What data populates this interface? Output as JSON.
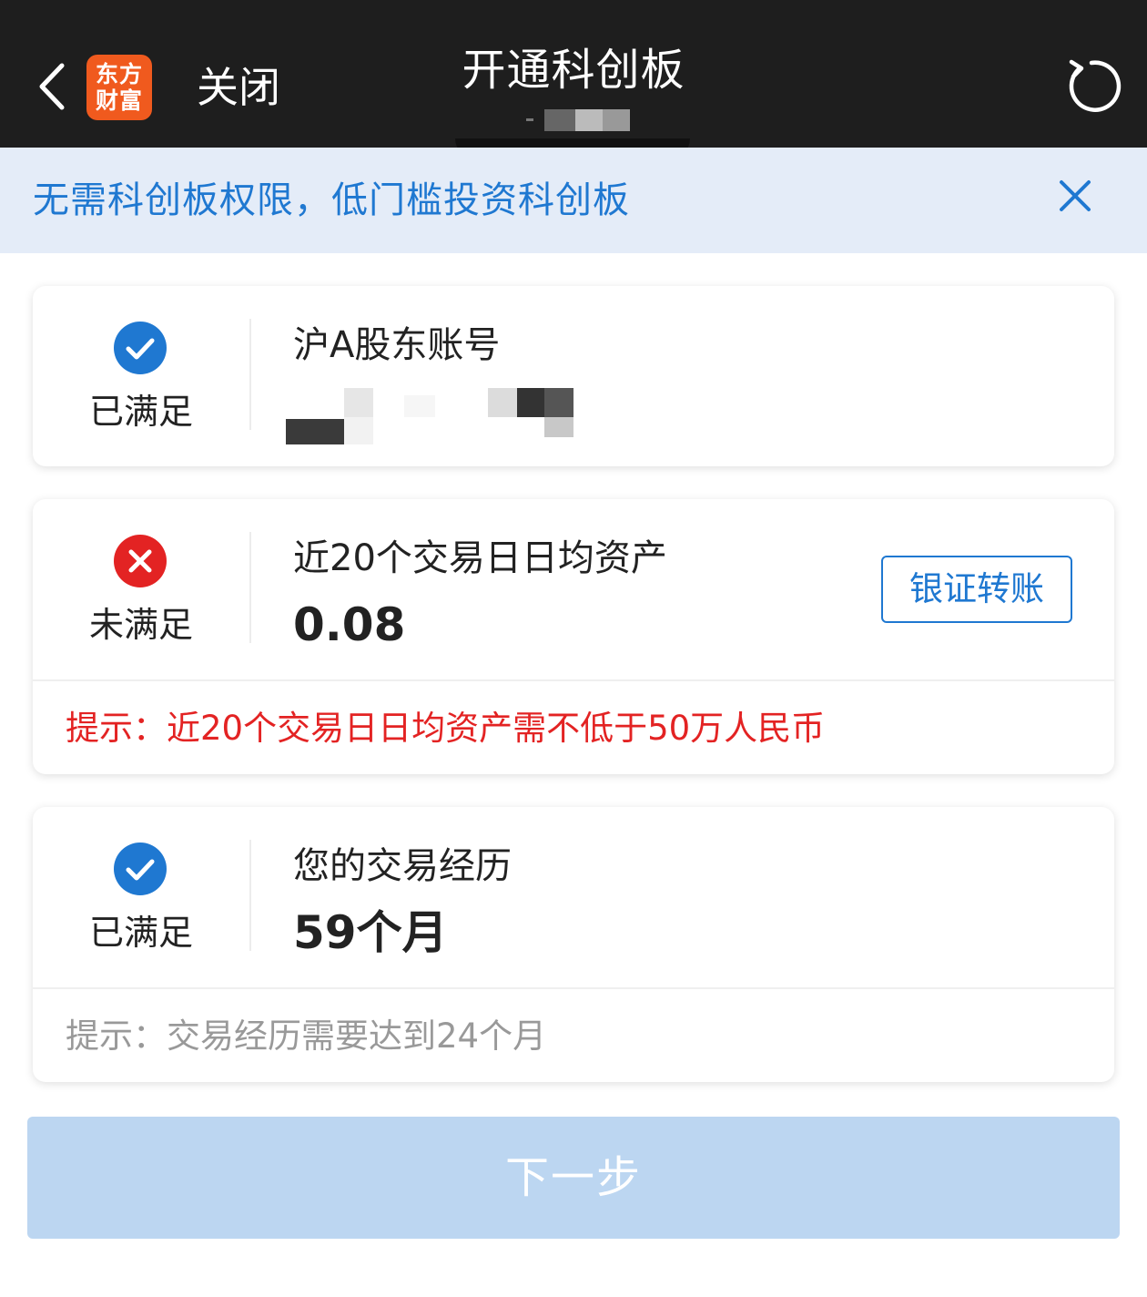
{
  "header": {
    "logo_line1": "东方",
    "logo_line2": "财富",
    "close_label": "关闭",
    "title": "开通科创板"
  },
  "banner": {
    "text": "无需科创板权限，低门槛投资科创板"
  },
  "cards": [
    {
      "status": "已满足",
      "status_type": "satisfied",
      "label": "沪A股东账号",
      "value": ""
    },
    {
      "status": "未满足",
      "status_type": "unsatisfied",
      "label": "近20个交易日日均资产",
      "value": "0.08",
      "action_label": "银证转账",
      "tip": "提示：近20个交易日日均资产需不低于50万人民币"
    },
    {
      "status": "已满足",
      "status_type": "satisfied",
      "label": "您的交易经历",
      "value": "59个月",
      "tip": "提示：交易经历需要达到24个月"
    }
  ],
  "next_button": {
    "label": "下一步"
  },
  "colors": {
    "header_bg": "#1e1e1e",
    "accent_blue": "#1f78d1",
    "error_red": "#e32323",
    "banner_bg": "#e4ecf8",
    "next_button_bg": "#bcd6f1",
    "logo_orange": "#f05a1e"
  },
  "icons": {
    "back": "chevron-left-icon",
    "refresh": "refresh-icon",
    "banner_close": "close-icon",
    "satisfied": "check-circle-icon",
    "unsatisfied": "x-circle-icon"
  }
}
